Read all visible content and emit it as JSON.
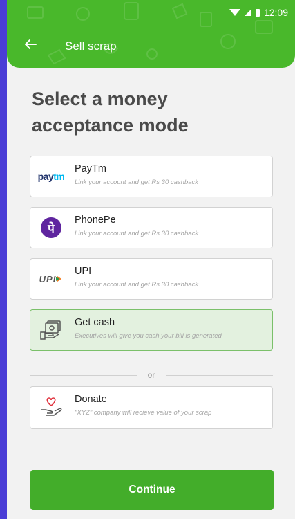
{
  "status": {
    "time": "12:09"
  },
  "header": {
    "title": "Sell scrap"
  },
  "heading": "Select a money acceptance mode",
  "options": [
    {
      "name": "PayTm",
      "subtitle": "Link your account and get Rs 30 cashback",
      "logo_text": "paytm",
      "icon": "paytm-logo"
    },
    {
      "name": "PhonePe",
      "subtitle": "Link your account and get Rs 30 cashback",
      "logo_text": "पे",
      "icon": "phonepe-logo"
    },
    {
      "name": "UPI",
      "subtitle": "Link your account and get Rs 30 cashback",
      "logo_text": "UPI",
      "icon": "upi-logo"
    },
    {
      "name": "Get cash",
      "subtitle": "Executives will give you cash your bill is generated",
      "icon": "cash-icon",
      "selected": true
    }
  ],
  "divider": "or",
  "donate": {
    "name": "Donate",
    "subtitle": "\"XYZ\" company will recieve value of your scrap",
    "icon": "donate-heart-hand-icon"
  },
  "continue_label": "Continue",
  "colors": {
    "primary": "#49b82b",
    "button": "#43ad2a",
    "selected_bg": "#e3f1df",
    "frame": "#4a3dd6"
  }
}
